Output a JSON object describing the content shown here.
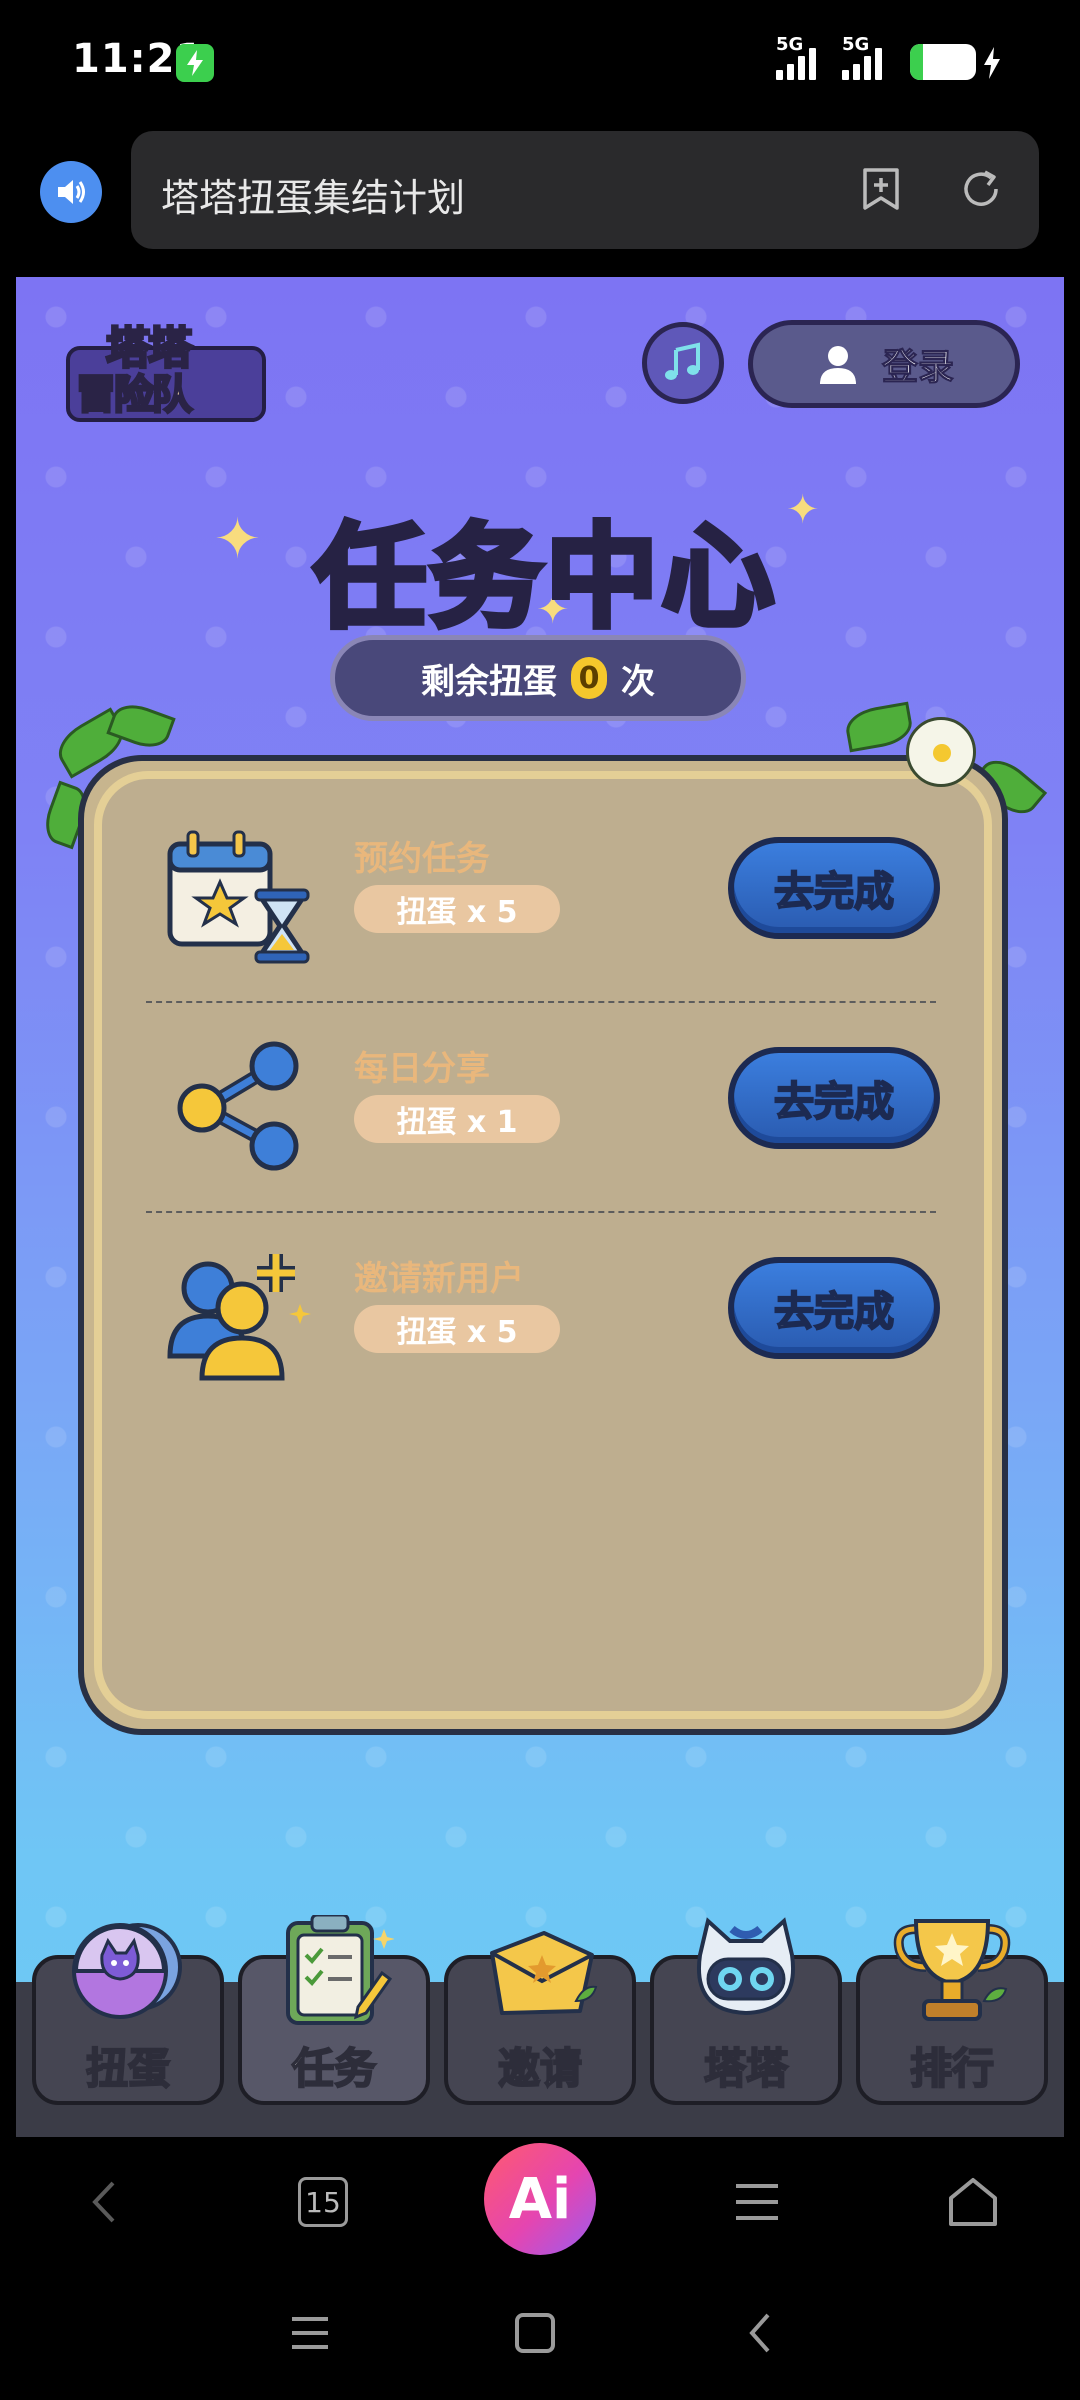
{
  "status_bar": {
    "time": "11:21",
    "net1": "5G",
    "net2": "5G",
    "battery_level": "20",
    "battery_fraction": 0.2,
    "charging": true
  },
  "browser": {
    "url_title": "塔塔扭蛋集结计划",
    "speaker_icon": "speaker-icon",
    "bookmark_icon": "bookmark-add-icon",
    "refresh_icon": "refresh-icon"
  },
  "header": {
    "logo_line1": "塔塔",
    "logo_line2": "冒险队",
    "music_icon": "music-note-icon",
    "login_label": "登录"
  },
  "title": "任务中心",
  "gacha": {
    "prefix": "剩余扭蛋",
    "count": "0",
    "suffix": "次"
  },
  "tasks": [
    {
      "name": "预约任务",
      "reward": "扭蛋 x 5",
      "button": "去完成",
      "icon": "calendar-hourglass-icon"
    },
    {
      "name": "每日分享",
      "reward": "扭蛋 x 1",
      "button": "去完成",
      "icon": "share-icon"
    },
    {
      "name": "邀请新用户",
      "reward": "扭蛋 x 5",
      "button": "去完成",
      "icon": "invite-user-icon"
    }
  ],
  "bottom_nav": [
    {
      "label": "扭蛋",
      "icon": "capsule-icon"
    },
    {
      "label": "任务",
      "icon": "clipboard-icon"
    },
    {
      "label": "邀请",
      "icon": "envelope-icon"
    },
    {
      "label": "塔塔",
      "icon": "robot-cat-icon"
    },
    {
      "label": "排行",
      "icon": "trophy-icon"
    }
  ],
  "toolbar": {
    "tab_count": "15",
    "ai_label": "Ai"
  },
  "colors": {
    "accent_blue": "#2a5bb0",
    "title_yellow": "#f6d65a",
    "panel_bg": "#c7b58e",
    "reward_pill": "#e9c7a1",
    "task_name": "#e9b77c"
  }
}
